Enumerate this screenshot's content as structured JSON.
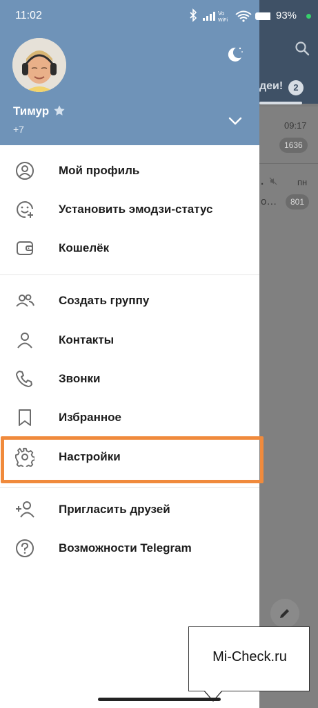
{
  "status_bar": {
    "time": "11:02",
    "network_label": "Vo WiFi",
    "battery": "93%"
  },
  "background": {
    "tab_label": "деи!",
    "tab_badge": "2",
    "rows": [
      {
        "time": "09:17",
        "badge": "1636",
        "text": ""
      },
      {
        "time": "пн",
        "badge": "801",
        "text": "…"
      }
    ]
  },
  "drawer": {
    "user_name": "Тимур",
    "user_phone": "+7",
    "menu_primary": [
      {
        "label": "Мой профиль",
        "icon": "profile-icon"
      },
      {
        "label": "Установить эмодзи-статус",
        "icon": "emoji-status-icon"
      },
      {
        "label": "Кошелёк",
        "icon": "wallet-icon"
      }
    ],
    "menu_secondary": [
      {
        "label": "Создать группу",
        "icon": "group-icon"
      },
      {
        "label": "Контакты",
        "icon": "contacts-icon"
      },
      {
        "label": "Звонки",
        "icon": "phone-icon"
      },
      {
        "label": "Избранное",
        "icon": "bookmark-icon"
      },
      {
        "label": "Настройки",
        "icon": "gear-icon"
      }
    ],
    "menu_tertiary": [
      {
        "label": "Пригласить друзей",
        "icon": "add-user-icon"
      },
      {
        "label": "Возможности Telegram",
        "icon": "help-icon"
      }
    ]
  },
  "colors": {
    "header_bg": "#6f93b8",
    "highlight": "#f08a3c",
    "icon": "#6b6b6b"
  },
  "watermark": {
    "text": "Mi-Check.ru"
  }
}
